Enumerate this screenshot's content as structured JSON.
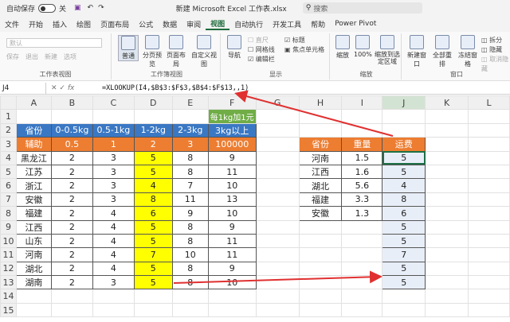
{
  "titlebar": {
    "autosave": "自动保存",
    "toggle": "关",
    "filename": "新建 Microsoft Excel 工作表.xlsx",
    "search": "搜索"
  },
  "tabs": [
    "文件",
    "开始",
    "插入",
    "绘图",
    "页面布局",
    "公式",
    "数据",
    "审阅",
    "视图",
    "自动执行",
    "开发工具",
    "帮助",
    "Power Pivot"
  ],
  "ribbon": {
    "sheetview": {
      "default": "默认",
      "keep": "保存",
      "exit": "退出",
      "new": "新建",
      "options": "选项",
      "label": "工作表视图"
    },
    "workbookview": {
      "normal": "普通",
      "pagebreak": "分页预览",
      "pagelayout": "页面布局",
      "custom": "自定义视图",
      "label": "工作簿视图"
    },
    "show": {
      "ruler": "直尺",
      "gridlines": "网格线",
      "formulabar": "编辑栏",
      "headings": "标题",
      "focus": "焦点单元格",
      "nav": "导航",
      "label": "显示"
    },
    "zoom": {
      "zoom": "缩放",
      "p100": "100%",
      "tosel": "缩放到选定区域",
      "label": "缩放"
    },
    "window": {
      "newwin": "新建窗口",
      "arrange": "全部重排",
      "freeze": "冻结窗格",
      "split": "拆分",
      "hide": "隐藏",
      "unhide": "取消隐藏",
      "label": "窗口"
    }
  },
  "formulabar": {
    "namebox": "J4",
    "formula": "=XLOOKUP(I4,$B$3:$F$3,$B$4:$F$13,,1)"
  },
  "columns": [
    "",
    "A",
    "B",
    "C",
    "D",
    "E",
    "F",
    "G",
    "H",
    "I",
    "J",
    "K",
    "L"
  ],
  "rows": [
    {
      "n": "1",
      "cells": [
        "",
        "",
        "",
        "",
        "",
        "每1kg加1元",
        "",
        "",
        "",
        "",
        "",
        ""
      ]
    },
    {
      "n": "2",
      "cells": [
        "省份",
        "0-0.5kg",
        "0.5-1kg",
        "1-2kg",
        "2-3kg",
        "3kg以上",
        "",
        "",
        "",
        "",
        "",
        ""
      ]
    },
    {
      "n": "3",
      "cells": [
        "辅助",
        "0.5",
        "1",
        "2",
        "3",
        "100000",
        "",
        "省份",
        "重量",
        "运费",
        "",
        ""
      ]
    },
    {
      "n": "4",
      "cells": [
        "黑龙江",
        "2",
        "3",
        "5",
        "8",
        "9",
        "",
        "河南",
        "1.5",
        "5",
        "",
        ""
      ]
    },
    {
      "n": "5",
      "cells": [
        "江苏",
        "2",
        "3",
        "5",
        "8",
        "11",
        "",
        "江西",
        "1.6",
        "5",
        "",
        ""
      ]
    },
    {
      "n": "6",
      "cells": [
        "浙江",
        "2",
        "3",
        "4",
        "7",
        "10",
        "",
        "湖北",
        "5.6",
        "4",
        "",
        ""
      ]
    },
    {
      "n": "7",
      "cells": [
        "安徽",
        "2",
        "3",
        "8",
        "11",
        "13",
        "",
        "福建",
        "3.3",
        "8",
        "",
        ""
      ]
    },
    {
      "n": "8",
      "cells": [
        "福建",
        "2",
        "4",
        "6",
        "9",
        "10",
        "",
        "安徽",
        "1.3",
        "6",
        "",
        ""
      ]
    },
    {
      "n": "9",
      "cells": [
        "江西",
        "2",
        "4",
        "5",
        "8",
        "9",
        "",
        "",
        "",
        "5",
        "",
        ""
      ]
    },
    {
      "n": "10",
      "cells": [
        "山东",
        "2",
        "4",
        "5",
        "8",
        "11",
        "",
        "",
        "",
        "5",
        "",
        ""
      ]
    },
    {
      "n": "11",
      "cells": [
        "河南",
        "2",
        "4",
        "7",
        "10",
        "11",
        "",
        "",
        "",
        "7",
        "",
        ""
      ]
    },
    {
      "n": "12",
      "cells": [
        "湖北",
        "2",
        "4",
        "5",
        "8",
        "9",
        "",
        "",
        "",
        "5",
        "",
        ""
      ]
    },
    {
      "n": "13",
      "cells": [
        "湖南",
        "2",
        "3",
        "5",
        "8",
        "10",
        "",
        "",
        "",
        "5",
        "",
        ""
      ]
    },
    {
      "n": "14",
      "cells": [
        "",
        "",
        "",
        "",
        "",
        "",
        "",
        "",
        "",
        "",
        "",
        ""
      ]
    },
    {
      "n": "15",
      "cells": [
        "",
        "",
        "",
        "",
        "",
        "",
        "",
        "",
        "",
        "",
        "",
        ""
      ]
    }
  ]
}
